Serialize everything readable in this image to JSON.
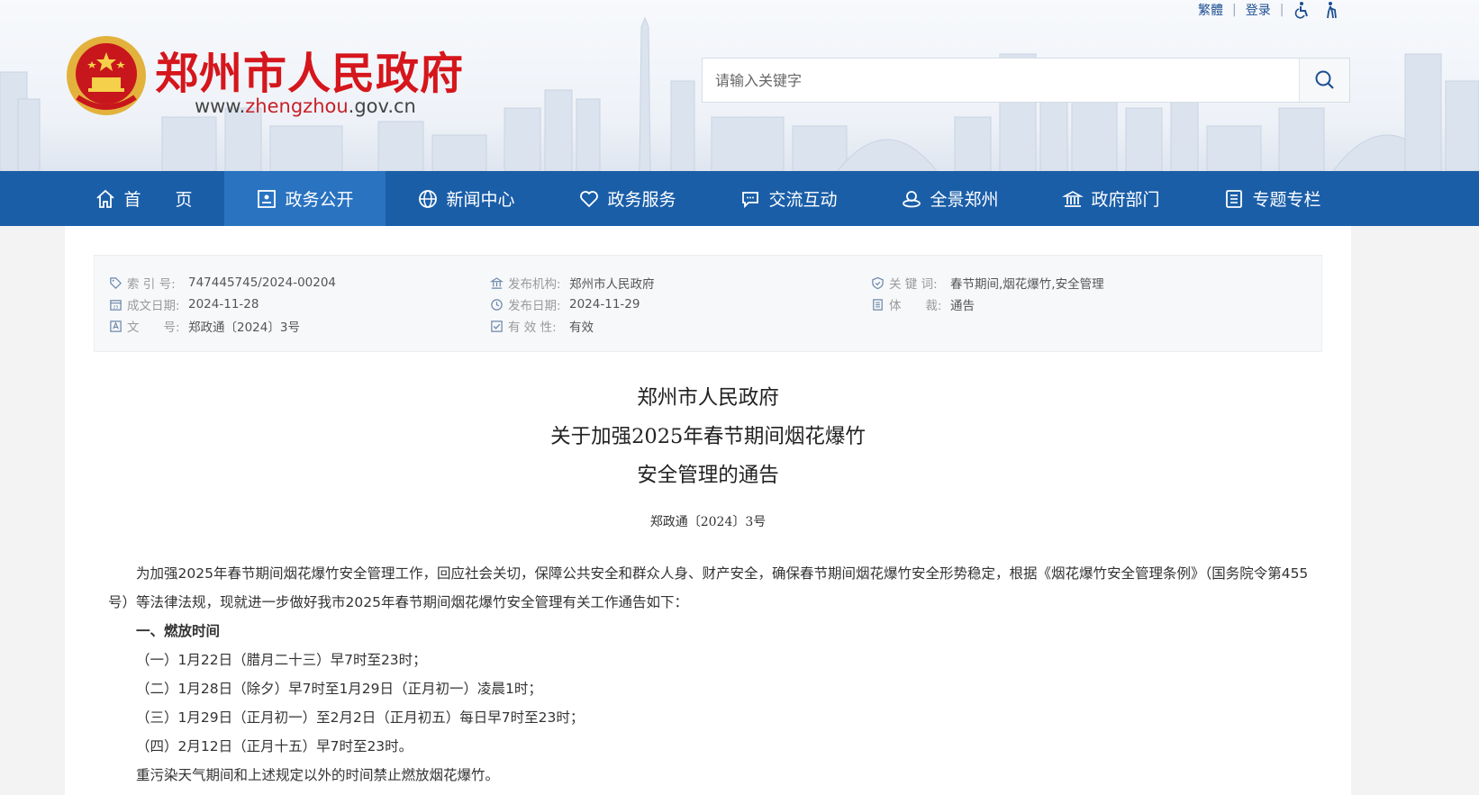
{
  "header": {
    "top_links": {
      "traditional": "繁體",
      "login": "登录"
    },
    "site_title": "郑州市人民政府",
    "site_url_prefix": "www.",
    "site_url_domain": "zhengzhou",
    "site_url_suffix": ".gov.cn",
    "search_placeholder": "请输入关键字"
  },
  "nav": {
    "items": [
      {
        "label": "首　　页",
        "icon": "home-icon"
      },
      {
        "label": "政务公开",
        "icon": "board-icon",
        "active": true
      },
      {
        "label": "新闻中心",
        "icon": "globe-icon"
      },
      {
        "label": "政务服务",
        "icon": "heart-icon"
      },
      {
        "label": "交流互动",
        "icon": "chat-icon"
      },
      {
        "label": "全景郑州",
        "icon": "panorama-icon"
      },
      {
        "label": "政府部门",
        "icon": "building-icon"
      },
      {
        "label": "专题专栏",
        "icon": "list-icon"
      }
    ]
  },
  "meta": {
    "index_label": "索 引 号:",
    "index_value": "747445745/2024-00204",
    "date_made_label": "成文日期:",
    "date_made_value": "2024-11-28",
    "doc_no_label": "文　　号:",
    "doc_no_value": "郑政通〔2024〕3号",
    "publisher_label": "发布机构:",
    "publisher_value": "郑州市人民政府",
    "pub_date_label": "发布日期:",
    "pub_date_value": "2024-11-29",
    "validity_label": "有 效 性:",
    "validity_value": "有效",
    "keywords_label": "关 键 词:",
    "keywords_value": "春节期间,烟花爆竹,安全管理",
    "genre_label": "体　　裁:",
    "genre_value": "通告"
  },
  "document": {
    "title_line1": "郑州市人民政府",
    "title_line2": "关于加强2025年春节期间烟花爆竹",
    "title_line3": "安全管理的通告",
    "number": "郑政通〔2024〕3号",
    "intro": "为加强2025年春节期间烟花爆竹安全管理工作，回应社会关切，保障公共安全和群众人身、财产安全，确保春节期间烟花爆竹安全形势稳定，根据《烟花爆竹安全管理条例》（国务院令第455号）等法律法规，现就进一步做好我市2025年春节期间烟花爆竹安全管理有关工作通告如下：",
    "section1": "一、燃放时间",
    "item1": "（一）1月22日（腊月二十三）早7时至23时；",
    "item2": "（二）1月28日（除夕）早7时至1月29日（正月初一）凌晨1时；",
    "item3": "（三）1月29日（正月初一）至2月2日（正月初五）每日早7时至23时；",
    "item4": "（四）2月12日（正月十五）早7时至23时。",
    "note": "重污染天气期间和上述规定以外的时间禁止燃放烟花爆竹。"
  },
  "colors": {
    "nav_bg": "#1a5ea8",
    "nav_active": "#2a73c1",
    "title_red": "#d5161c"
  }
}
